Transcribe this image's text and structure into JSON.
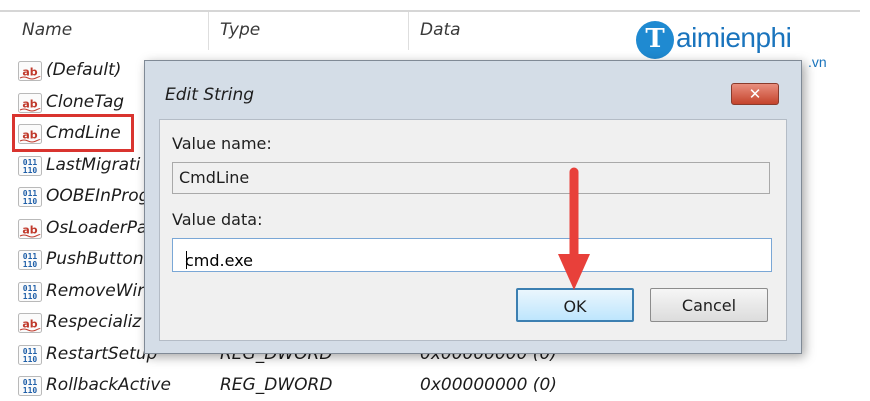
{
  "columns": {
    "name": "Name",
    "type": "Type",
    "data": "Data"
  },
  "logo": {
    "letter": "T",
    "text": "aimienphi",
    "suffix": ".vn"
  },
  "entries": [
    {
      "name": "(Default)",
      "icon": "string-value-icon",
      "type": "",
      "data": ""
    },
    {
      "name": "CloneTag",
      "icon": "string-value-icon",
      "type": "",
      "data": ""
    },
    {
      "name": "CmdLine",
      "icon": "string-value-icon",
      "type": "",
      "data": ""
    },
    {
      "name": "LastMigrati",
      "icon": "dword-value-icon",
      "type": "",
      "data": ""
    },
    {
      "name": "OOBEInProg",
      "icon": "dword-value-icon",
      "type": "",
      "data": ""
    },
    {
      "name": "OsLoaderPa",
      "icon": "string-value-icon",
      "type": "",
      "data": ""
    },
    {
      "name": "PushButton",
      "icon": "dword-value-icon",
      "type": "",
      "data": ""
    },
    {
      "name": "RemoveWir",
      "icon": "dword-value-icon",
      "type": "",
      "data": ""
    },
    {
      "name": "Respecializ",
      "icon": "string-value-icon",
      "type": "",
      "data": ""
    },
    {
      "name": "RestartSetup",
      "icon": "dword-value-icon",
      "type": "REG_DWORD",
      "data": "0x00000000 (0)"
    },
    {
      "name": "RollbackActive",
      "icon": "dword-value-icon",
      "type": "REG_DWORD",
      "data": "0x00000000 (0)"
    }
  ],
  "dialog": {
    "title": "Edit String",
    "close_label": "✕",
    "value_name_label": "Value name:",
    "value_name": "CmdLine",
    "value_data_label": "Value data:",
    "value_data": "cmd.exe",
    "ok_label": "OK",
    "cancel_label": "Cancel"
  },
  "colors": {
    "highlight": "#d9342f",
    "arrow": "#e8403a",
    "dialog_frame": "#d4dde7",
    "logo": "#1a74bd"
  }
}
